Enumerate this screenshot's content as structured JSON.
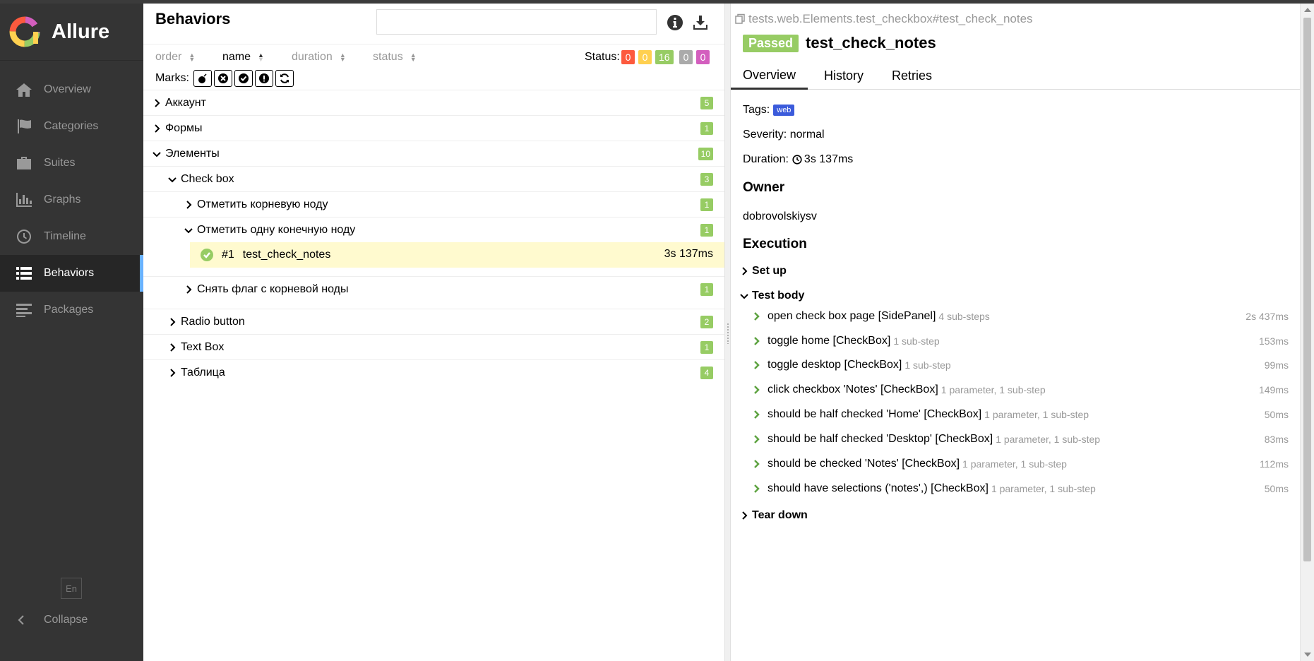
{
  "app": {
    "name": "Allure"
  },
  "colors": {
    "sidebar_bg": "#343434",
    "active_accent": "#69b2ff",
    "passed": "#97cc64",
    "failed": "#fd5a3e",
    "broken": "#ffd050",
    "skipped": "#aaaaaa",
    "unknown": "#d35ebe",
    "selected_row": "#fffacf",
    "tag": "#3b5bdb"
  },
  "sidebar": {
    "items": [
      {
        "label": "Overview",
        "icon": "home-icon"
      },
      {
        "label": "Categories",
        "icon": "flag-icon"
      },
      {
        "label": "Suites",
        "icon": "briefcase-icon"
      },
      {
        "label": "Graphs",
        "icon": "bar-chart-icon"
      },
      {
        "label": "Timeline",
        "icon": "clock-icon"
      },
      {
        "label": "Behaviors",
        "icon": "list-icon",
        "active": true
      },
      {
        "label": "Packages",
        "icon": "align-left-icon"
      }
    ],
    "language": "En",
    "collapse_label": "Collapse"
  },
  "behaviors": {
    "title": "Behaviors",
    "search": {
      "value": "",
      "placeholder": ""
    },
    "sort": {
      "order": "order",
      "name": "name",
      "duration": "duration",
      "status": "status"
    },
    "status_label": "Status:",
    "status_counts": {
      "failed": "0",
      "broken": "0",
      "passed": "16",
      "skipped": "0",
      "unknown": "0"
    },
    "marks_label": "Marks:",
    "tree": [
      {
        "label": "Аккаунт",
        "count": "5"
      },
      {
        "label": "Формы",
        "count": "1"
      },
      {
        "label": "Элементы",
        "count": "10"
      },
      {
        "label": "Check box",
        "count": "3"
      },
      {
        "label": "Отметить корневую ноду",
        "count": "1"
      },
      {
        "label": "Отметить одну конечную ноду",
        "count": "1"
      },
      {
        "label": "test_check_notes",
        "number": "#1",
        "duration": "3s 137ms"
      },
      {
        "label": "Снять флаг с корневой ноды",
        "count": "1"
      },
      {
        "label": "Radio button",
        "count": "2"
      },
      {
        "label": "Text Box",
        "count": "1"
      },
      {
        "label": "Таблица",
        "count": "4"
      }
    ]
  },
  "test": {
    "full_name": "tests.web.Elements.test_checkbox#test_check_notes",
    "status": "Passed",
    "name": "test_check_notes",
    "tabs": [
      "Overview",
      "History",
      "Retries"
    ],
    "tags_label": "Tags:",
    "tag": "web",
    "severity": "Severity: normal",
    "duration_label": "Duration:",
    "duration": "3s 137ms",
    "owner_heading": "Owner",
    "owner": "dobrovolskiysv",
    "execution_heading": "Execution",
    "setup_label": "Set up",
    "body_label": "Test body",
    "teardown_label": "Tear down",
    "steps": [
      {
        "name": "open check box page [SidePanel]",
        "sub": "4 sub-steps",
        "duration": "2s 437ms"
      },
      {
        "name": "toggle home [CheckBox]",
        "sub": "1 sub-step",
        "duration": "153ms"
      },
      {
        "name": "toggle desktop [CheckBox]",
        "sub": "1 sub-step",
        "duration": "99ms"
      },
      {
        "name": "click checkbox 'Notes' [CheckBox]",
        "sub": "1 parameter, 1 sub-step",
        "duration": "149ms"
      },
      {
        "name": "should be half checked 'Home' [CheckBox]",
        "sub": "1 parameter, 1 sub-step",
        "duration": "50ms"
      },
      {
        "name": "should be half checked 'Desktop' [CheckBox]",
        "sub": "1 parameter, 1 sub-step",
        "duration": "83ms"
      },
      {
        "name": "should be checked 'Notes' [CheckBox]",
        "sub": "1 parameter, 1 sub-step",
        "duration": "112ms"
      },
      {
        "name": "should have selections ('notes',) [CheckBox]",
        "sub": "1 parameter, 1 sub-step",
        "duration": "50ms"
      }
    ]
  }
}
